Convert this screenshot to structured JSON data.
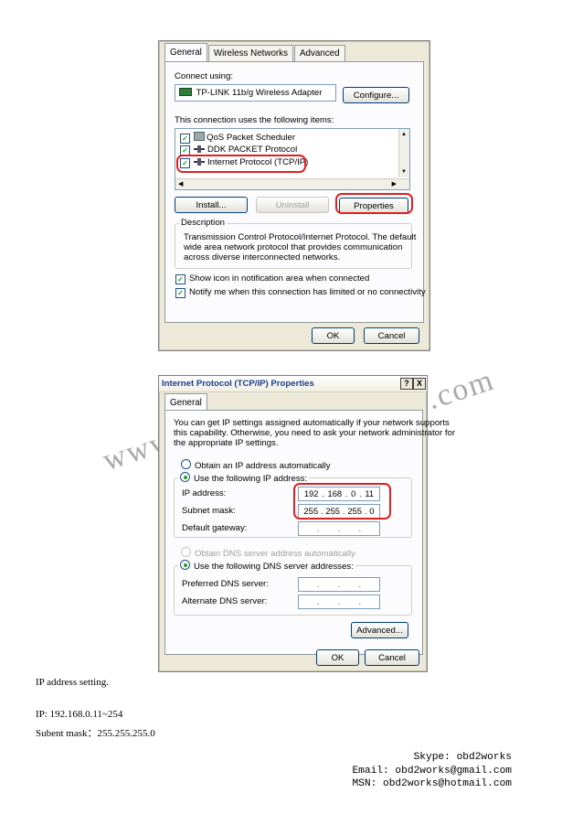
{
  "watermark": {
    "left": "www.",
    "right": ".com"
  },
  "lan_dialog": {
    "tabs": [
      "General",
      "Wireless Networks",
      "Advanced"
    ],
    "connect_using_label": "Connect using:",
    "adapter_name": "TP-LINK 11b/g Wireless Adapter",
    "configure_button": "Configure...",
    "items_label": "This connection uses the following items:",
    "items": [
      {
        "label": "QoS Packet Scheduler",
        "checked": true
      },
      {
        "label": "DDK PACKET Protocol",
        "checked": true
      },
      {
        "label": "Internet Protocol (TCP/IP)",
        "checked": true
      }
    ],
    "install_button": "Install...",
    "uninstall_button": "Uninstall",
    "properties_button": "Properties",
    "description_label": "Description",
    "description_text": [
      "Transmission Control Protocol/Internet Protocol. The default",
      "wide area network protocol that provides communication",
      "across diverse interconnected networks."
    ],
    "show_icon_label": "Show icon in notification area when connected",
    "notify_label": "Notify me when this connection has limited or no connectivity",
    "ok_button": "OK",
    "cancel_button": "Cancel"
  },
  "tcpip_dialog": {
    "title": "Internet Protocol (TCP/IP) Properties",
    "help_button": "?",
    "close_button": "X",
    "tab": "General",
    "intro": [
      "You can get IP settings assigned automatically if your network supports",
      "this capability. Otherwise, you need to ask your network administrator for",
      "the appropriate IP settings."
    ],
    "obtain_ip_auto": "Obtain an IP address automatically",
    "use_following_ip": "Use the following IP address:",
    "ip_address_label": "IP address:",
    "ip_address": [
      "192",
      "168",
      "0",
      "11"
    ],
    "subnet_mask_label": "Subnet mask:",
    "subnet_mask": [
      "255",
      "255",
      "255",
      "0"
    ],
    "default_gateway_label": "Default gateway:",
    "obtain_dns_auto": "Obtain DNS server address automatically",
    "use_following_dns": "Use the following DNS server addresses:",
    "preferred_dns_label": "Preferred DNS server:",
    "alternate_dns_label": "Alternate DNS server:",
    "advanced_button": "Advanced...",
    "ok_button": "OK",
    "cancel_button": "Cancel"
  },
  "notes": {
    "heading": "IP address setting.",
    "ip_line": "IP: 192.168.0.11~254",
    "subnet_line": "Subent mask：255.255.255.0"
  },
  "contact": {
    "skype": "Skype: obd2works",
    "email": "Email: obd2works@gmail.com",
    "msn": "MSN: obd2works@hotmail.com"
  }
}
